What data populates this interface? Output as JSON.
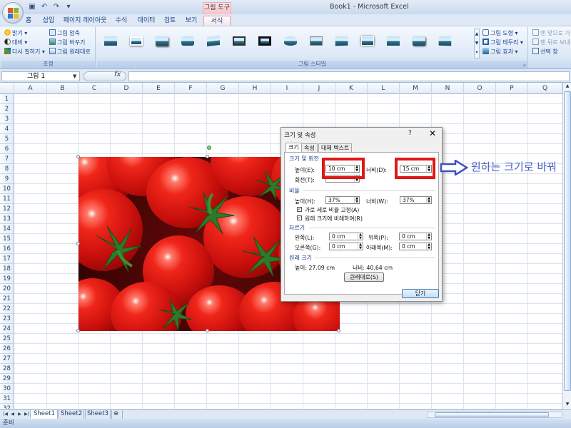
{
  "titlebar": {
    "app_title": "Book1 - Microsoft Excel",
    "context_title": "그림 도구",
    "qat_icons": [
      "save-icon",
      "undo-icon",
      "redo-icon",
      "customize-icon"
    ]
  },
  "tabs": [
    "홈",
    "삽입",
    "페이지 레이아웃",
    "수식",
    "데이터",
    "검토",
    "보기",
    "서식"
  ],
  "active_tab": "서식",
  "ribbon": {
    "adjust": {
      "label": "조정",
      "brightness": "밝기 ▾",
      "contrast": "대비 ▾",
      "recolor": "다시 칠하기 ▾",
      "compress": "그림 압축",
      "change_picture": "그림 바꾸기",
      "reset_picture": "그림 원래대로"
    },
    "styles": {
      "label": "그림 스타일",
      "thumbnail_count": 10
    },
    "picture_tools": {
      "shape": "그림 도형 ▾",
      "border": "그림 테두리 ▾",
      "effects": "그림 효과 ▾"
    },
    "arrange": {
      "bring_front": "맨 앞으로 가",
      "send_back": "맨 뒤로 보내",
      "selection_pane": "선택 창"
    }
  },
  "formula_bar": {
    "name_box": "그림 1",
    "fx": "fx",
    "formula": ""
  },
  "grid": {
    "columns": [
      "A",
      "B",
      "C",
      "D",
      "E",
      "F",
      "G",
      "H",
      "I",
      "J",
      "K",
      "L",
      "M",
      "N",
      "O",
      "P",
      "Q"
    ],
    "rows": [
      "1",
      "2",
      "3",
      "4",
      "5",
      "6",
      "7",
      "8",
      "9",
      "10",
      "11",
      "12",
      "13",
      "14",
      "15",
      "16",
      "17",
      "18",
      "19",
      "20",
      "21",
      "22",
      "23",
      "24",
      "25",
      "26",
      "27",
      "28",
      "29",
      "30",
      "31",
      "32"
    ]
  },
  "dialog": {
    "title": "크기 및 속성",
    "help": "?",
    "close": "✕",
    "tabs": [
      "크기",
      "속성",
      "대체 텍스트"
    ],
    "active_tab": "크기",
    "size_rotate_section": "크기 및 회전",
    "height_label": "높이(E):",
    "height_value": "10 cm",
    "width_label": "너비(D):",
    "width_value": "15 cm",
    "rotation_label": "회전(T):",
    "rotation_value": "",
    "scale_section": "비율",
    "scale_height_label": "높이(H):",
    "scale_height_value": "37%",
    "scale_width_label": "너비(W):",
    "scale_width_value": "37%",
    "lock_aspect": "가로 세로 비율 고정(A)",
    "relative_original": "원래 크기에 비례하여(R)",
    "crop_section": "자르기",
    "crop_left_label": "왼쪽(L):",
    "crop_left_value": "0 cm",
    "crop_top_label": "위쪽(P):",
    "crop_top_value": "0 cm",
    "crop_right_label": "오른쪽(G):",
    "crop_right_value": "0 cm",
    "crop_bottom_label": "아래쪽(M):",
    "crop_bottom_value": "0 cm",
    "original_section": "원래 크기",
    "original_height": "높이:   27.09 cm",
    "original_width": "너비:   40.64 cm",
    "reset_button": "원래대로(S)",
    "close_button": "닫기"
  },
  "annotation": {
    "text": "원하는 크기로 바꿔"
  },
  "sheets": [
    "Sheet1",
    "Sheet2",
    "Sheet3"
  ],
  "active_sheet": "Sheet1",
  "status": "준비"
}
